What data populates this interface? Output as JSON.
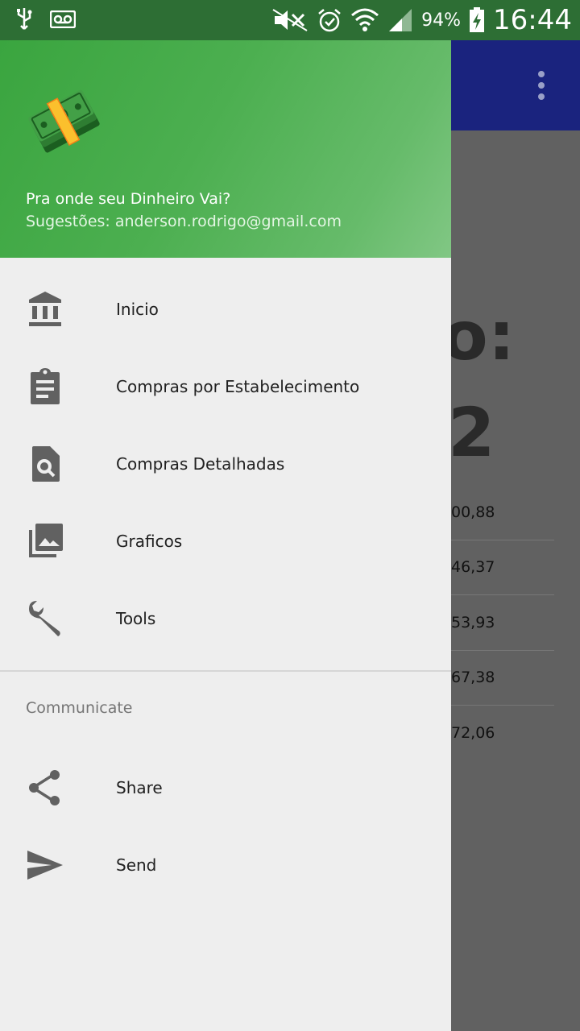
{
  "status_bar": {
    "battery_percent": "94%",
    "clock": "16:44",
    "icons": [
      "usb-icon",
      "voicemail-icon",
      "mute-icon",
      "alarm-icon",
      "wifi-icon",
      "signal-icon",
      "battery-charging-icon"
    ]
  },
  "drawer": {
    "header": {
      "title": "Pra onde seu Dinheiro Vai?",
      "subtitle": "Sugestões: anderson.rodrigo@gmail.com"
    },
    "items": [
      {
        "label": "Inicio",
        "icon": "bank-icon"
      },
      {
        "label": "Compras por Estabelecimento",
        "icon": "clipboard-icon"
      },
      {
        "label": "Compras Detalhadas",
        "icon": "find-in-page-icon"
      },
      {
        "label": "Graficos",
        "icon": "photo-library-icon"
      },
      {
        "label": "Tools",
        "icon": "wrench-icon"
      }
    ],
    "section_label": "Communicate",
    "section_items": [
      {
        "label": "Share",
        "icon": "share-icon"
      },
      {
        "label": "Send",
        "icon": "send-icon"
      }
    ]
  },
  "background": {
    "big_text_1": "o:",
    "big_text_2": "2",
    "rows": [
      "00,88",
      "46,37",
      "53,93",
      "67,38",
      "72,06"
    ]
  },
  "colors": {
    "status_bar": "#2d6e34",
    "header_gradient_start": "#3aa53f",
    "header_gradient_end": "#81c784",
    "drawer_bg": "#eeeeee",
    "toolbar_bg": "#1a237e",
    "icon_gray": "#616161"
  }
}
